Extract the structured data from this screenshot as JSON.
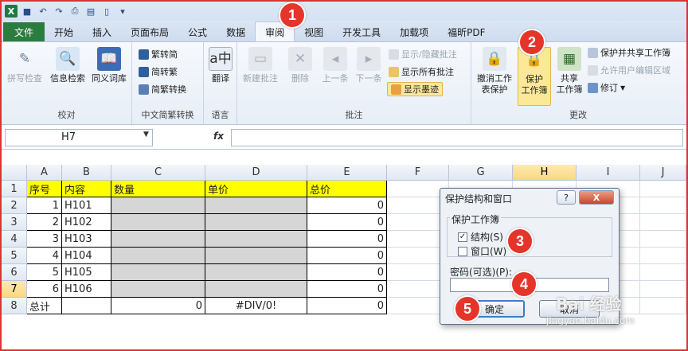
{
  "tabs": {
    "file": "文件",
    "items": [
      "开始",
      "插入",
      "页面布局",
      "公式",
      "数据",
      "审阅",
      "视图",
      "开发工具",
      "加载项",
      "福昕PDF"
    ]
  },
  "ribbon": {
    "proof": {
      "label": "校对",
      "spell": "拼写检查",
      "research": "信息检索",
      "thesaurus": "同义词库"
    },
    "chinese": {
      "label": "中文简繁转换",
      "to_simple": "繁转简",
      "to_trad": "简转繁",
      "convert": "简繁转换"
    },
    "language": {
      "label": "语言",
      "translate": "翻译"
    },
    "comments": {
      "label": "批注",
      "new": "新建批注",
      "delete": "删除",
      "prev": "上一条",
      "next": "下一条",
      "show_hide": "显示/隐藏批注",
      "show_all": "显示所有批注",
      "show_ink": "显示墨迹"
    },
    "changes": {
      "label": "更改",
      "unprotect_l1": "撤消工作",
      "unprotect_l2": "表保护",
      "protect_l1": "保护",
      "protect_l2": "工作簿",
      "share_l1": "共享",
      "share_l2": "工作簿",
      "protect_share": "保护并共享工作簿",
      "allow_edit": "允许用户编辑区域",
      "track": "修订"
    }
  },
  "formula_bar": {
    "name_box": "H7",
    "fx": "fx",
    "value": ""
  },
  "sheet": {
    "columns": [
      "A",
      "B",
      "C",
      "D",
      "E",
      "F",
      "G",
      "H",
      "I",
      "J"
    ],
    "rows": [
      "1",
      "2",
      "3",
      "4",
      "5",
      "6",
      "7",
      "8"
    ],
    "header": [
      "序号",
      "内容",
      "数量",
      "单价",
      "总价"
    ],
    "data": [
      [
        "1",
        "H101",
        "",
        "",
        "0"
      ],
      [
        "2",
        "H102",
        "",
        "",
        "0"
      ],
      [
        "3",
        "H103",
        "",
        "",
        "0"
      ],
      [
        "4",
        "H104",
        "",
        "",
        "0"
      ],
      [
        "5",
        "H105",
        "",
        "",
        "0"
      ],
      [
        "6",
        "H106",
        "",
        "",
        "0"
      ]
    ],
    "total": [
      "总计",
      "",
      "0",
      "#DIV/0!",
      "0"
    ]
  },
  "dialog": {
    "title": "保护结构和窗口",
    "help": "?",
    "close": "X",
    "group": "保护工作簿",
    "structure": "结构(S)",
    "window": "窗口(W)",
    "password_label": "密码(可选)(P):",
    "password_value": "",
    "ok": "确定",
    "cancel": "取消",
    "structure_checked": true,
    "window_checked": false
  },
  "markers": [
    "1",
    "2",
    "3",
    "4",
    "5"
  ],
  "watermark": {
    "brand": "Bai 经验",
    "url": "jingyan.baidu.com"
  },
  "colors": {
    "file_tab": "#2a7d3f",
    "highlight": "#fde89a",
    "marker": "#e5352b",
    "yellow": "#ffff00",
    "gray": "#d6d6d6"
  }
}
